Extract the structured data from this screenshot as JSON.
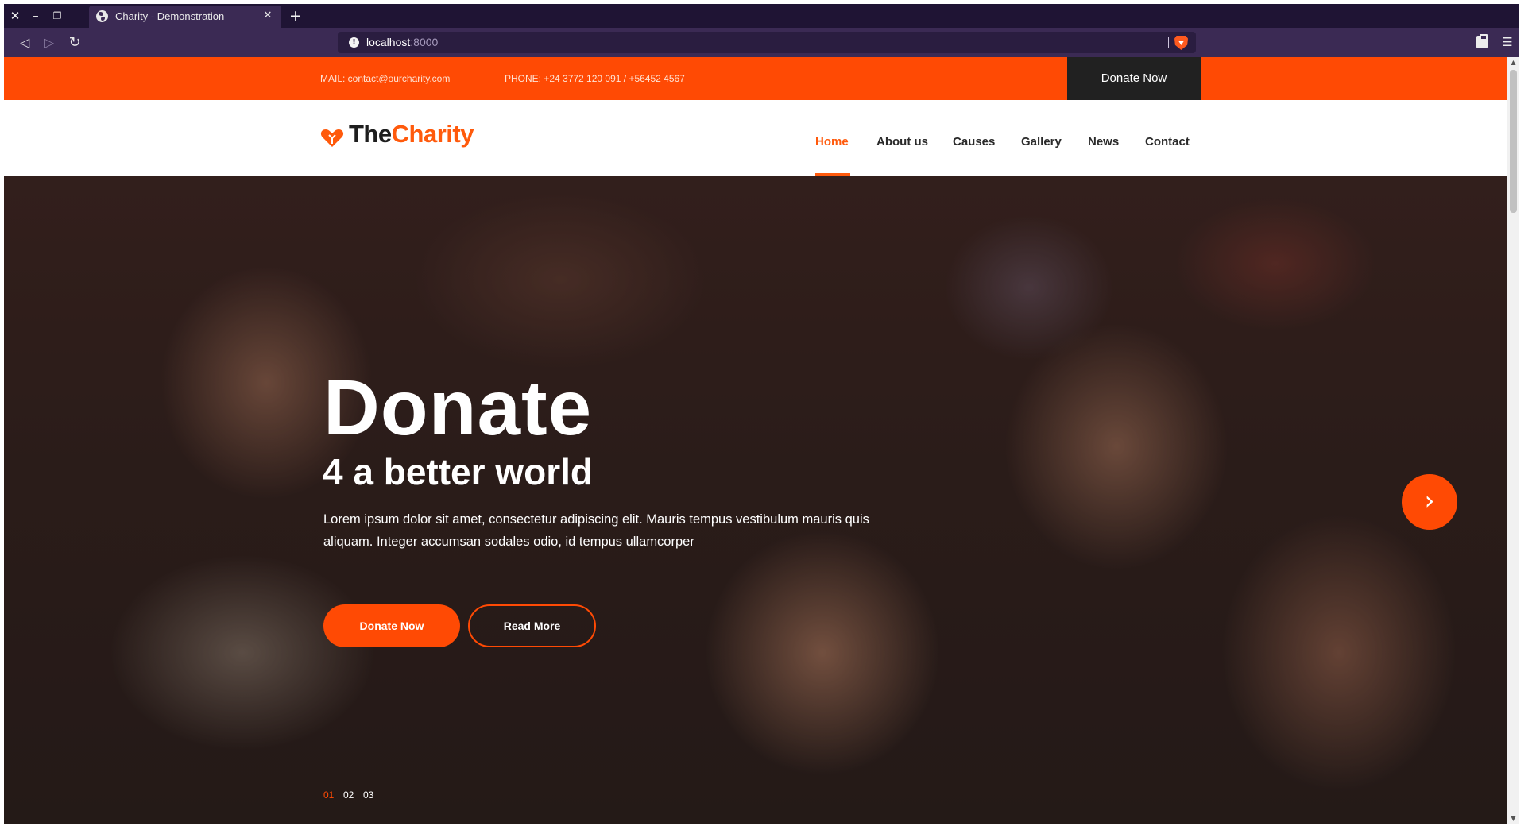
{
  "browser": {
    "tab_title": "Charity - Demonstration",
    "url_host": "localhost",
    "url_port": ":8000",
    "window_buttons": {
      "close": "✕",
      "minimize": "–",
      "restore": "❐"
    },
    "new_tab": "+",
    "tab_close": "✕",
    "back": "◁",
    "forward": "▷",
    "reload": "↻",
    "menu": "☰",
    "info": "!"
  },
  "topbar": {
    "mail": "MAIL: contact@ourcharity.com",
    "phone": "PHONE: +24 3772 120 091 / +56452 4567",
    "donate_label": "Donate Now"
  },
  "header": {
    "logo_the": "The",
    "logo_charity": "Charity",
    "nav": [
      {
        "label": "Home",
        "active": true
      },
      {
        "label": "About us",
        "active": false
      },
      {
        "label": "Causes",
        "active": false
      },
      {
        "label": "Gallery",
        "active": false
      },
      {
        "label": "News",
        "active": false
      },
      {
        "label": "Contact",
        "active": false
      }
    ]
  },
  "hero": {
    "title": "Donate",
    "subtitle": "4 a better world",
    "text": "Lorem ipsum dolor sit amet, consectetur adipiscing elit. Mauris tempus vestibulum mauris quis aliquam. Integer accumsan sodales odio, id tempus ullamcorper",
    "donate_button": "Donate Now",
    "read_more_button": "Read More",
    "next_arrow": "›",
    "pages": [
      "01",
      "02",
      "03"
    ],
    "active_page": "01"
  },
  "colors": {
    "accent": "#ff4a04",
    "dark": "#212121",
    "chrome_dark": "#1f1434",
    "chrome_toolbar": "#3b2a54"
  }
}
